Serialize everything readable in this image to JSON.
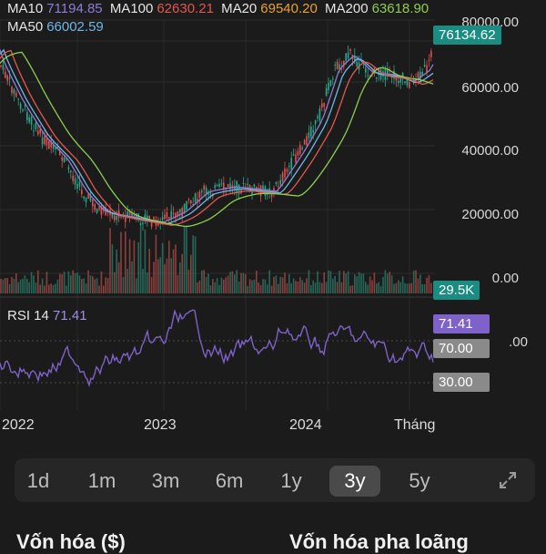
{
  "moving_averages": {
    "ma10": {
      "label": "MA10",
      "value": "71194.85",
      "color": "#8e7cd6"
    },
    "ma100": {
      "label": "MA100",
      "value": "62630.21",
      "color": "#e2584f"
    },
    "ma20": {
      "label": "MA20",
      "value": "69540.20",
      "color": "#e9a234"
    },
    "ma200": {
      "label": "MA200",
      "value": "63618.90",
      "color": "#8ccf4d"
    },
    "ma50": {
      "label": "MA50",
      "value": "66002.59",
      "color": "#6fb7e6"
    }
  },
  "price_axis": [
    "80000.00",
    "60000.00",
    "40000.00",
    "20000.00",
    "0.00"
  ],
  "current_price": "76134.62",
  "volume_tag": "29.5K",
  "rsi": {
    "label": "RSI 14",
    "value": "71.41",
    "overbought": "70.00",
    "oversold": "30.00",
    "overlap_text": ".00"
  },
  "x_axis": [
    "2022",
    "2023",
    "2024",
    "Tháng"
  ],
  "timeframes": [
    {
      "label": "1d",
      "active": false
    },
    {
      "label": "1m",
      "active": false
    },
    {
      "label": "3m",
      "active": false
    },
    {
      "label": "6m",
      "active": false
    },
    {
      "label": "1y",
      "active": false
    },
    {
      "label": "3y",
      "active": true
    },
    {
      "label": "5y",
      "active": false
    }
  ],
  "bottom": {
    "market_cap": "Vốn hóa ($)",
    "diluted_cap": "Vốn hóa pha loãng"
  }
}
